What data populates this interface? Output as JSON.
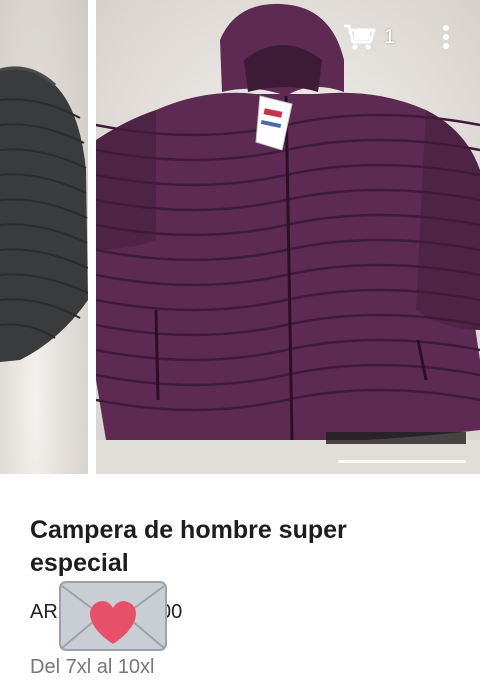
{
  "toolbar": {
    "cart_icon": "cart-icon",
    "cart_count": "1",
    "more_icon": "more-vert-icon"
  },
  "carousel": {
    "main_jacket_color": "#5c2a52",
    "prev_jacket_color": "#3a3b3c"
  },
  "listing": {
    "title": "Campera de hombre super especial",
    "price_prefix": "AR",
    "price_suffix": "00",
    "subtitle": "Del 7xl al 10xl",
    "sticker_icon": "heart-envelope-icon"
  }
}
